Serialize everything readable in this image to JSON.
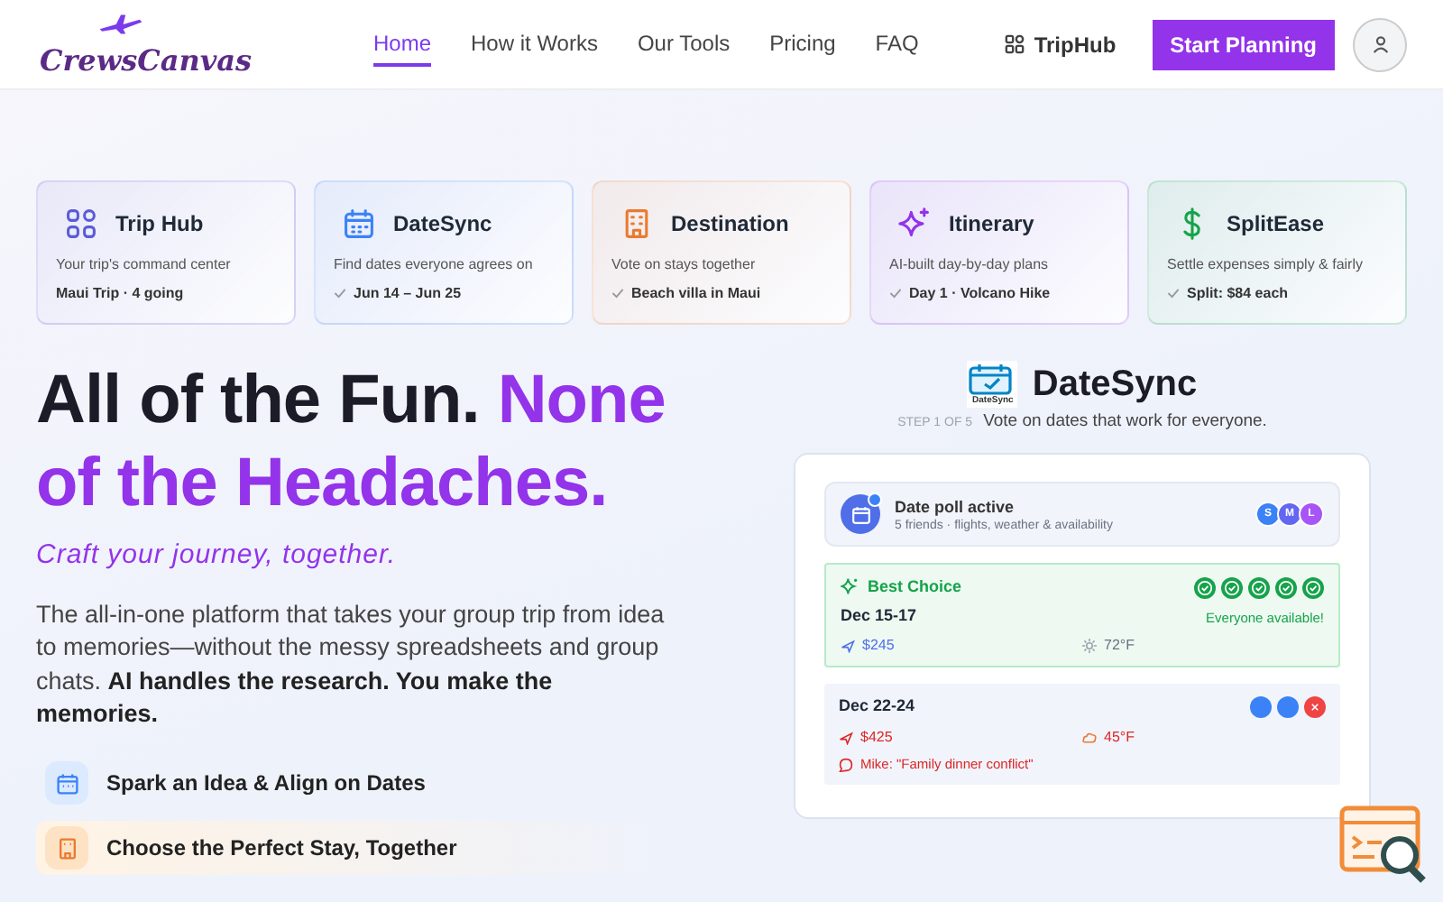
{
  "brand": "CrewsCanvas",
  "nav": [
    {
      "label": "Home",
      "selected": true
    },
    {
      "label": "How it Works",
      "selected": false
    },
    {
      "label": "Our Tools",
      "selected": false
    },
    {
      "label": "Pricing",
      "selected": false
    },
    {
      "label": "FAQ",
      "selected": false
    }
  ],
  "triphub_link": "TripHub",
  "cta": "Start Planning",
  "cards": [
    {
      "kind": "grid",
      "color": "#5b5bd6",
      "title": "Trip Hub",
      "subtitle": "Your trip's command center",
      "status": "Maui Trip · 4 going",
      "checked": false
    },
    {
      "kind": "calendar",
      "color": "#3b82f6",
      "title": "DateSync",
      "subtitle": "Find dates everyone agrees on",
      "status": "Jun 14 – Jun 25",
      "checked": true
    },
    {
      "kind": "building",
      "color": "#ea7a2f",
      "title": "Destination",
      "subtitle": "Vote on stays together",
      "status": "Beach villa in Maui",
      "checked": true
    },
    {
      "kind": "sparkle",
      "color": "#9333ea",
      "title": "Itinerary",
      "subtitle": "AI-built day-by-day plans",
      "status": "Day 1 · Volcano Hike",
      "checked": true
    },
    {
      "kind": "dollar",
      "color": "#16a34a",
      "title": "SplitEase",
      "subtitle": "Settle expenses simply & fairly",
      "status": "Split: $84 each",
      "checked": true
    }
  ],
  "hero": {
    "title": "All of the Fun. ",
    "title_accent": "None of the Headaches.",
    "tagline": "Craft your journey, together.",
    "body": "The all-in-one platform that takes your group trip from idea to memories—without the messy spreadsheets and group chats. **AI handles the research. You make the memories.**"
  },
  "features": [
    {
      "kind": "calendar",
      "label": "Spark an Idea & Align on Dates",
      "selected": false
    },
    {
      "kind": "building",
      "label": "Choose the Perfect Stay, Together",
      "selected": true
    }
  ],
  "demo": {
    "logo_caption": "DateSync",
    "title": "DateSync",
    "step": "STEP 1 OF 5",
    "description": "Vote on dates that work for everyone.",
    "poll": {
      "title": "Date poll active",
      "subtitle": "5 friends · flights, weather & availability",
      "avatars": [
        {
          "initial": "S",
          "color": "#3b82f6"
        },
        {
          "initial": "M",
          "color": "#6366f1"
        },
        {
          "initial": "L",
          "color": "#a855f7"
        }
      ]
    },
    "options": [
      {
        "kind": "best",
        "badge": "Best Choice",
        "dates": "Dec 15-17",
        "note": "Everyone available!",
        "price": "$245",
        "weather": "72°F",
        "votes": [
          {
            "kind": "yes"
          },
          {
            "kind": "yes"
          },
          {
            "kind": "yes"
          },
          {
            "kind": "yes"
          },
          {
            "kind": "yes"
          }
        ]
      },
      {
        "kind": "normal",
        "dates": "Dec 22-24",
        "price": "$425",
        "weather": "45°F",
        "comment": "Mike: \"Family dinner conflict\"",
        "votes": [
          {
            "kind": "pending"
          },
          {
            "kind": "pending"
          },
          {
            "kind": "no"
          }
        ]
      }
    ]
  }
}
